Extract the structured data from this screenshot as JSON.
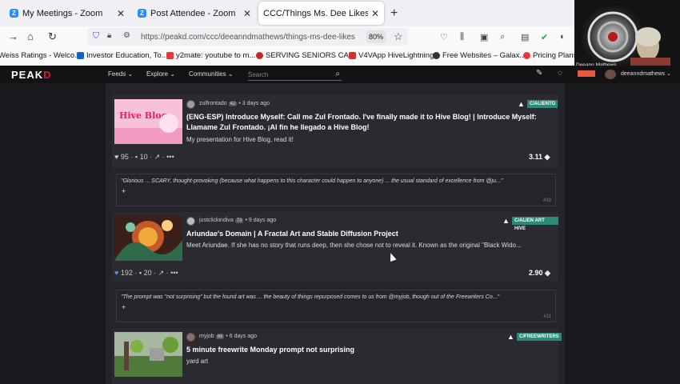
{
  "tabs": [
    {
      "label": "My Meetings - Zoom",
      "icon": "zoom-icon"
    },
    {
      "label": "Post Attendee - Zoom",
      "icon": "zoom-icon"
    },
    {
      "label": "CCC/Things Ms. Dee Likes, Edition 1"
    }
  ],
  "address": {
    "url": "https://peakd.com/ccc/deeanndmathews/things-ms-dee-likes",
    "zoom": "80%"
  },
  "bookmarks": [
    "Weiss Ratings - Welco...",
    "Investor Education, To...",
    "y2mate: youtube to m...",
    "SERVING SENIORS CA...",
    "V4VApp HiveLightning",
    "Free Websites – Galax...",
    "Pricing Plans |"
  ],
  "video": {
    "name": "Deeann Mathews"
  },
  "peakd": {
    "logo": "PEAK",
    "logo_accent": "D",
    "nav": {
      "feeds": "Feeds",
      "explore": "Explore",
      "communities": "Communities"
    },
    "search_placeholder": "Search",
    "username": "deeanndmathews"
  },
  "posts": [
    {
      "author": "zulfrontado",
      "rep": "42",
      "age": "3 days ago",
      "community": "C/ALIENTO",
      "title": "(ENG-ESP) Introduce Myself: Call me Zul Frontado. I've finally made it to Hive Blog! | Introduce Myself: Llamame Zul Frontado. ¡Al fin he llegado a Hive Blog!",
      "desc": "My presentation for Hive Blog, read it!",
      "thumb_text": "Hive Blog",
      "votes": "95",
      "comments": "10",
      "payout": "3.11"
    },
    {
      "author": "justclickindiva",
      "rep": "73",
      "age": "9 days ago",
      "community": "C/ALIEN ART HIVE",
      "title": "Ariundae's Domain | A Fractal Art and Stable Diffusion Project",
      "desc": "Meet Ariundae. If she has no story that runs deep, then she chose not to reveal it. Known as the original \"Black Wido...",
      "votes": "192",
      "comments": "20",
      "payout": "2.90"
    },
    {
      "author": "myjob",
      "rep": "69",
      "age": "6 days ago",
      "community": "C/FREEWRITERS",
      "title": "5 minute freewrite Monday prompt not surprising",
      "desc": "yard art"
    }
  ],
  "quotes": [
    {
      "text": "\"Glorious ... SCARY, thought-provoking (because what happens to this character could happen to anyone) ... the usual standard of excellence from @ju...\"",
      "num": "#10"
    },
    {
      "text": "\"The prompt was \"not surprising\" but the found art was ... the beauty of things repurposed comes to us from @myjob, though out of the Freewriters Co...\"",
      "num": "#11"
    }
  ],
  "ui": {
    "plus": "+",
    "dots": "•••"
  }
}
